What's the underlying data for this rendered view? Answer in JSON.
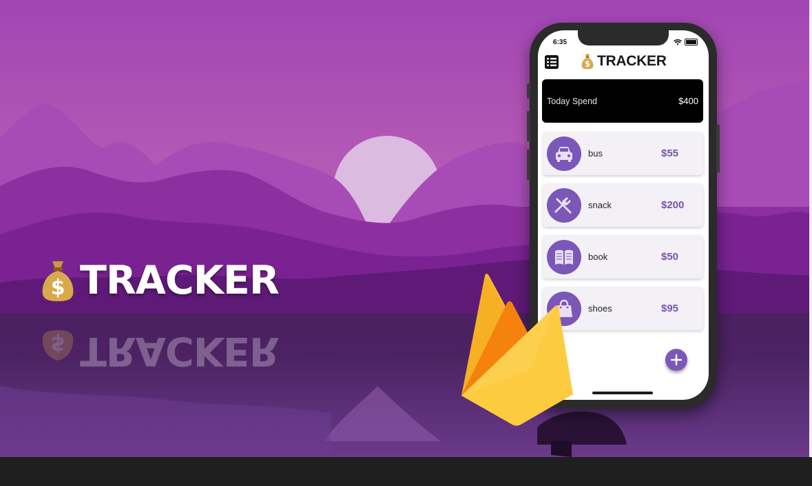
{
  "banner": {
    "logo_text": "TRACKER",
    "logo_emoji": "money-bag",
    "colors": {
      "sky": "#a148b3",
      "reflection": "#5e2a72",
      "bottom_bar": "#1f1f1f"
    }
  },
  "phone": {
    "status_time": "6:35",
    "app_title": "TRACKER",
    "menu_icon": "list-menu-icon",
    "today": {
      "label": "Today Spend",
      "amount": "$400"
    },
    "expenses": [
      {
        "name": "bus",
        "amount": "$55",
        "icon": "car-icon"
      },
      {
        "name": "snack",
        "amount": "$200",
        "icon": "fork-knife-icon"
      },
      {
        "name": "book",
        "amount": "$50",
        "icon": "book-icon"
      },
      {
        "name": "shoes",
        "amount": "$95",
        "icon": "shopping-bag-icon"
      }
    ],
    "fab_icon": "plus-icon",
    "accent": "#7b58b8"
  },
  "firebase_logo": "firebase-flame-icon"
}
